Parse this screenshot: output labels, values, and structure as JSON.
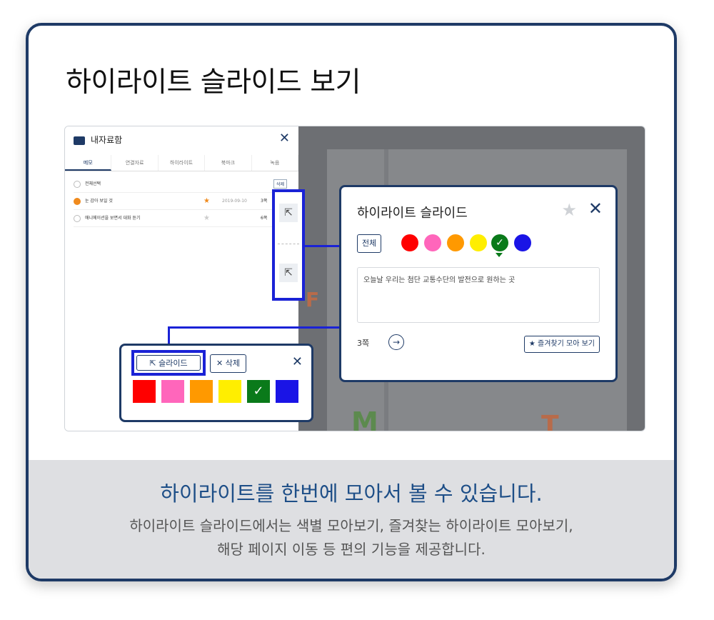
{
  "page_title": "하이라이트 슬라이드 보기",
  "footer": {
    "title": "하이라이트를 한번에 모아서 볼 수 있습니다.",
    "desc_line1": "하이라이트 슬라이드에서는 색별 모아보기, 즐겨찾는 하이라이트 모아보기,",
    "desc_line2": "해당 페이지 이동 등 편의 기능을 제공합니다."
  },
  "panel": {
    "title": "내자료함",
    "tabs": [
      "메모",
      "연결자료",
      "하이라이트",
      "북마크",
      "녹음"
    ],
    "select_all": "전체선택",
    "delete_label": "삭제",
    "rows": [
      {
        "text": "눈 감아 보일 것",
        "date": "2019-09-10",
        "page": "3쪽"
      },
      {
        "text": "애니메이션을 보면서 대화 듣기",
        "page": "6쪽"
      }
    ]
  },
  "popup": {
    "title": "하이라이트 슬라이드",
    "all_label": "전체",
    "memo_text": "오늘날 우리는 첨단 교통수단의 발전으로 원하는 곳",
    "page_label": "3쪽",
    "fav_label": "즐겨찾기 모아 보기",
    "colors": [
      "#ff0000",
      "#ff66bb",
      "#ff9900",
      "#ffee00",
      "#0a7a1a",
      "#1a14e6"
    ]
  },
  "mini": {
    "slide_label": "슬라이드",
    "delete_label": "삭제",
    "colors": [
      "#ff0000",
      "#ff66bb",
      "#ff9900",
      "#ffee00",
      "#0a7a1a",
      "#1a14e6"
    ]
  },
  "icons": {
    "close": "✕",
    "star": "★",
    "external": "⇱",
    "check": "✓",
    "arrow": "→"
  }
}
